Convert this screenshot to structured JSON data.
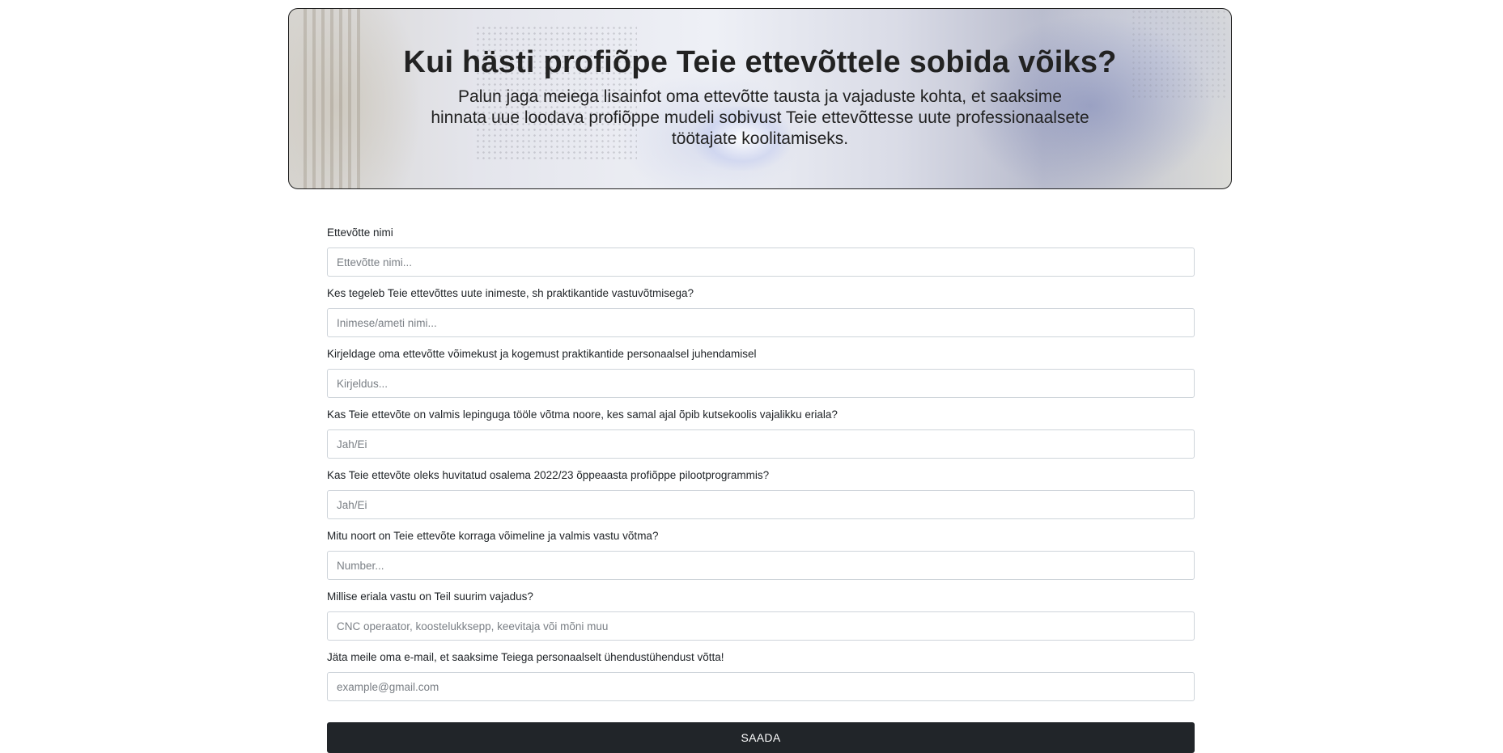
{
  "hero": {
    "title": "Kui hästi profiõpe Teie ettevõttele sobida võiks?",
    "subtitle": "Palun jaga meiega lisainfot oma ettevõtte tausta ja vajaduste kohta, et saaksime hinnata uue loodava profiõppe mudeli sobivust Teie ettevõttesse uute professionaalsete töötajate koolitamiseks."
  },
  "form": {
    "fields": [
      {
        "label": "Ettevõtte nimi",
        "placeholder": "Ettevõtte nimi...",
        "value": ""
      },
      {
        "label": "Kes tegeleb Teie ettevõttes uute inimeste, sh praktikantide vastuvõtmisega?",
        "placeholder": "Inimese/ameti nimi...",
        "value": ""
      },
      {
        "label": "Kirjeldage oma ettevõtte võimekust ja kogemust praktikantide personaalsel juhendamisel",
        "placeholder": "Kirjeldus...",
        "value": ""
      },
      {
        "label": "Kas Teie ettevõte on valmis lepinguga tööle võtma noore, kes samal ajal õpib kutsekoolis vajalikku eriala?",
        "placeholder": "Jah/Ei",
        "value": ""
      },
      {
        "label": "Kas Teie ettevõte oleks huvitatud osalema 2022/23 õppeaasta profiõppe pilootprogrammis?",
        "placeholder": "Jah/Ei",
        "value": ""
      },
      {
        "label": "Mitu noort on Teie ettevõte korraga võimeline ja valmis vastu võtma?",
        "placeholder": "Number...",
        "value": ""
      },
      {
        "label": "Millise eriala vastu on Teil suurim vajadus?",
        "placeholder": "CNC operaator, koostelukksepp, keevitaja või mõni muu",
        "value": ""
      },
      {
        "label": "Jäta meile oma e-mail, et saaksime Teiega personaalselt ühendustühendust võtta!",
        "placeholder": "example@gmail.com",
        "value": ""
      }
    ],
    "submit_label": "SAADA"
  }
}
